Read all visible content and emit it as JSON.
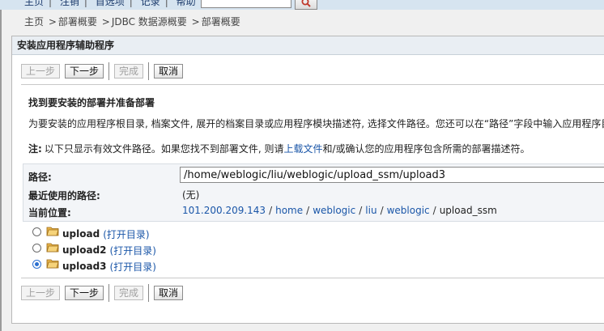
{
  "topnav": {
    "items": [
      "主页",
      "注销",
      "首选项",
      "记录",
      "帮助"
    ]
  },
  "breadcrumb": {
    "items": [
      "主页",
      "部署概要",
      "JDBC 数据源概要",
      "部署概要"
    ],
    "separator": ">"
  },
  "panel": {
    "title": "安装应用程序辅助程序"
  },
  "buttons": {
    "back": "上一步",
    "next": "下一步",
    "finish": "完成",
    "cancel": "取消"
  },
  "section": {
    "title": "找到要安装的部署并准备部署",
    "description": "为要安装的应用程序根目录, 档案文件, 展开的档案目录或应用程序模块描述符, 选择文件路径。您还可以在“路径”字段中输入应用程序目",
    "note_label": "注:",
    "note_before": "以下只显示有效文件路径。如果您找不到部署文件, 则请",
    "note_link": "上载文件",
    "note_after": "和/或确认您的应用程序包含所需的部署描述符。"
  },
  "path": {
    "label": "路径:",
    "value": "/home/weblogic/liu/weblogic/upload_ssm/upload3",
    "recent_label": "最近使用的路径:",
    "recent_value": "(无)",
    "current_label": "当前位置:",
    "location": {
      "host": "101.200.209.143",
      "segments": [
        "home",
        "weblogic",
        "liu",
        "weblogic"
      ],
      "current": "upload_ssm",
      "separator": "/"
    }
  },
  "files": [
    {
      "name": "upload",
      "action": "(打开目录)",
      "selected": false
    },
    {
      "name": "upload2",
      "action": "(打开目录)",
      "selected": false
    },
    {
      "name": "upload3",
      "action": "(打开目录)",
      "selected": true
    }
  ],
  "colors": {
    "link": "#1a56a8",
    "panel_header": "#e9eef3",
    "radio_selected": "#2a6fd0"
  }
}
